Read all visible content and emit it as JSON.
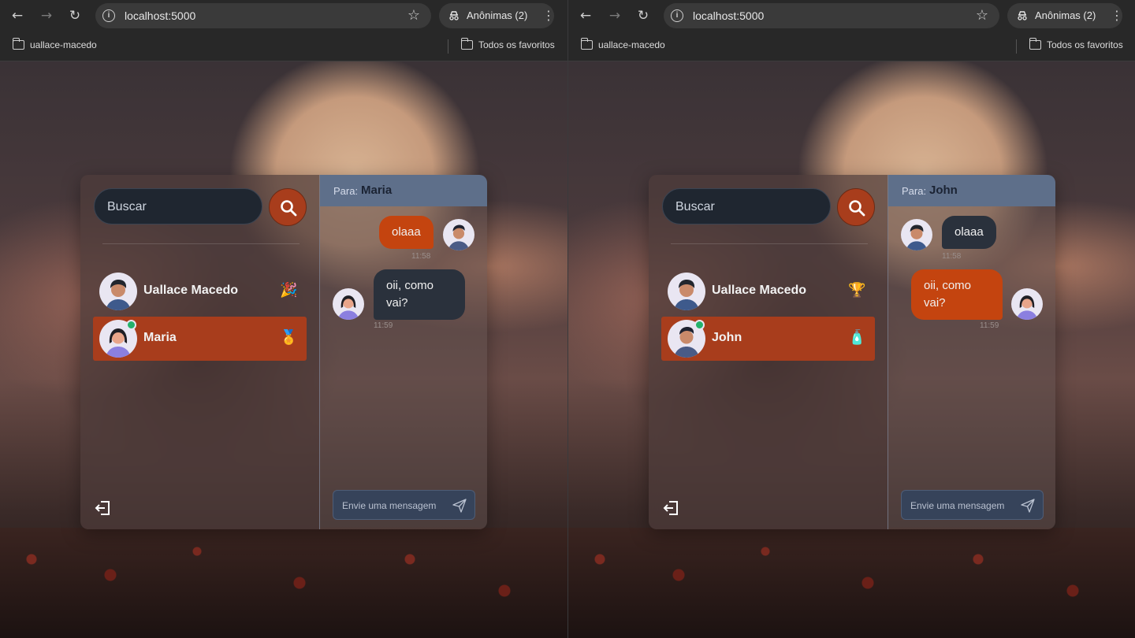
{
  "windows": [
    {
      "browser": {
        "url": "localhost:5000",
        "incognito_label": "Anônimas (2)",
        "bookmark_folder": "uallace-macedo",
        "favorites_label": "Todos os favoritos"
      },
      "app": {
        "search_placeholder": "Buscar",
        "contacts": [
          {
            "name": "Uallace Macedo",
            "badge_icon": "party-popper-icon",
            "badge_glyph": "🎉",
            "online": false,
            "active": false
          },
          {
            "name": "Maria",
            "badge_icon": "medal-icon",
            "badge_glyph": "🏅",
            "online": true,
            "active": true
          }
        ],
        "chat": {
          "to_prefix": "Para:",
          "to_name": "Maria",
          "messages": [
            {
              "text": "olaaa",
              "time": "11:58",
              "from_me": true
            },
            {
              "text": "oii, como vai?",
              "time": "11:59",
              "from_me": false
            }
          ],
          "composer_placeholder": "Envie uma mensagem"
        }
      }
    },
    {
      "browser": {
        "url": "localhost:5000",
        "incognito_label": "Anônimas (2)",
        "bookmark_folder": "uallace-macedo",
        "favorites_label": "Todos os favoritos"
      },
      "app": {
        "search_placeholder": "Buscar",
        "contacts": [
          {
            "name": "Uallace Macedo",
            "badge_icon": "trophy-icon",
            "badge_glyph": "🏆",
            "online": false,
            "active": false
          },
          {
            "name": "John",
            "badge_icon": "bottle-icon",
            "badge_glyph": "🧴",
            "online": true,
            "active": true
          }
        ],
        "chat": {
          "to_prefix": "Para:",
          "to_name": "John",
          "messages": [
            {
              "text": "olaaa",
              "time": "11:58",
              "from_me": false
            },
            {
              "text": "oii, como vai?",
              "time": "11:59",
              "from_me": true
            }
          ],
          "composer_placeholder": "Envie uma mensagem"
        }
      }
    }
  ],
  "colors": {
    "accent": "#a83d1c",
    "bubble_me": "#c4440f",
    "bubble_them": "#2a313c",
    "chat_header": "#5e6f8a",
    "online": "#23b26b"
  }
}
